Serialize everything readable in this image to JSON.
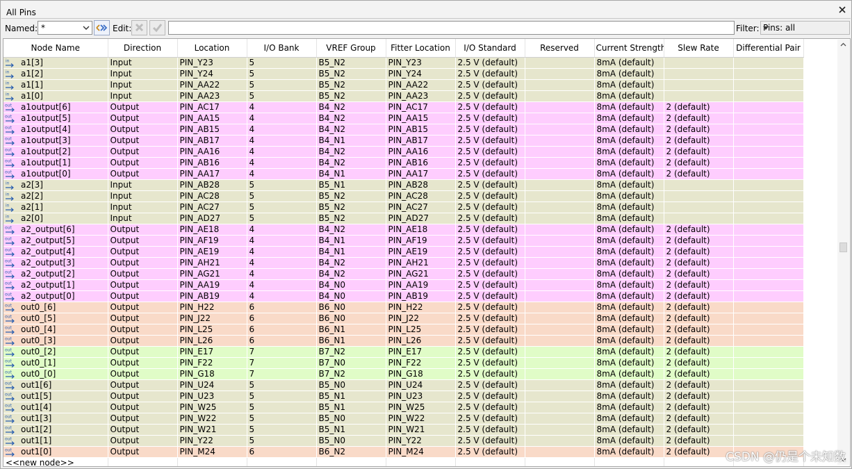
{
  "window": {
    "title": "All Pins"
  },
  "toolbar": {
    "named_label": "Named:",
    "named_value": "*",
    "edit_label": "Edit:",
    "edit_value": "",
    "filter_label": "Filter:",
    "filter_value": "Pins: all"
  },
  "columns": [
    "Node Name",
    "Direction",
    "Location",
    "I/O Bank",
    "VREF Group",
    "Fitter Location",
    "I/O Standard",
    "Reserved",
    "Current Strength",
    "Slew Rate",
    "Differential Pair"
  ],
  "colors": {
    "input_row": "#e6e6cd",
    "output_bank4": "#fecdfe",
    "output_bank6": "#f9dac8",
    "output_bank7": "#e0fcc7",
    "output_bank5": "#e6e6cd",
    "input_icon": "#3c7fc7",
    "output_icon": "#3c7fc7"
  },
  "rows": [
    {
      "icon": "input-pin-icon",
      "name": "a1[3]",
      "direction": "Input",
      "location": "PIN_Y23",
      "bank": "5",
      "vref": "B5_N2",
      "fitter": "PIN_Y23",
      "standard": "2.5 V (default)",
      "reserved": "",
      "strength": "8mA (default)",
      "slew": "",
      "diff": "",
      "color": "#e6e6cd"
    },
    {
      "icon": "input-pin-icon",
      "name": "a1[2]",
      "direction": "Input",
      "location": "PIN_Y24",
      "bank": "5",
      "vref": "B5_N2",
      "fitter": "PIN_Y24",
      "standard": "2.5 V (default)",
      "reserved": "",
      "strength": "8mA (default)",
      "slew": "",
      "diff": "",
      "color": "#e6e6cd"
    },
    {
      "icon": "input-pin-icon",
      "name": "a1[1]",
      "direction": "Input",
      "location": "PIN_AA22",
      "bank": "5",
      "vref": "B5_N2",
      "fitter": "PIN_AA22",
      "standard": "2.5 V (default)",
      "reserved": "",
      "strength": "8mA (default)",
      "slew": "",
      "diff": "",
      "color": "#e6e6cd"
    },
    {
      "icon": "input-pin-icon",
      "name": "a1[0]",
      "direction": "Input",
      "location": "PIN_AA23",
      "bank": "5",
      "vref": "B5_N2",
      "fitter": "PIN_AA23",
      "standard": "2.5 V (default)",
      "reserved": "",
      "strength": "8mA (default)",
      "slew": "",
      "diff": "",
      "color": "#e6e6cd"
    },
    {
      "icon": "output-pin-icon",
      "name": "a1output[6]",
      "direction": "Output",
      "location": "PIN_AC17",
      "bank": "4",
      "vref": "B4_N2",
      "fitter": "PIN_AC17",
      "standard": "2.5 V (default)",
      "reserved": "",
      "strength": "8mA (default)",
      "slew": "2 (default)",
      "diff": "",
      "color": "#fecdfe"
    },
    {
      "icon": "output-pin-icon",
      "name": "a1output[5]",
      "direction": "Output",
      "location": "PIN_AA15",
      "bank": "4",
      "vref": "B4_N2",
      "fitter": "PIN_AA15",
      "standard": "2.5 V (default)",
      "reserved": "",
      "strength": "8mA (default)",
      "slew": "2 (default)",
      "diff": "",
      "color": "#fecdfe"
    },
    {
      "icon": "output-pin-icon",
      "name": "a1output[4]",
      "direction": "Output",
      "location": "PIN_AB15",
      "bank": "4",
      "vref": "B4_N2",
      "fitter": "PIN_AB15",
      "standard": "2.5 V (default)",
      "reserved": "",
      "strength": "8mA (default)",
      "slew": "2 (default)",
      "diff": "",
      "color": "#fecdfe"
    },
    {
      "icon": "output-pin-icon",
      "name": "a1output[3]",
      "direction": "Output",
      "location": "PIN_AB17",
      "bank": "4",
      "vref": "B4_N1",
      "fitter": "PIN_AB17",
      "standard": "2.5 V (default)",
      "reserved": "",
      "strength": "8mA (default)",
      "slew": "2 (default)",
      "diff": "",
      "color": "#fecdfe"
    },
    {
      "icon": "output-pin-icon",
      "name": "a1output[2]",
      "direction": "Output",
      "location": "PIN_AA16",
      "bank": "4",
      "vref": "B4_N2",
      "fitter": "PIN_AA16",
      "standard": "2.5 V (default)",
      "reserved": "",
      "strength": "8mA (default)",
      "slew": "2 (default)",
      "diff": "",
      "color": "#fecdfe"
    },
    {
      "icon": "output-pin-icon",
      "name": "a1output[1]",
      "direction": "Output",
      "location": "PIN_AB16",
      "bank": "4",
      "vref": "B4_N2",
      "fitter": "PIN_AB16",
      "standard": "2.5 V (default)",
      "reserved": "",
      "strength": "8mA (default)",
      "slew": "2 (default)",
      "diff": "",
      "color": "#fecdfe"
    },
    {
      "icon": "output-pin-icon",
      "name": "a1output[0]",
      "direction": "Output",
      "location": "PIN_AA17",
      "bank": "4",
      "vref": "B4_N1",
      "fitter": "PIN_AA17",
      "standard": "2.5 V (default)",
      "reserved": "",
      "strength": "8mA (default)",
      "slew": "2 (default)",
      "diff": "",
      "color": "#fecdfe"
    },
    {
      "icon": "input-pin-icon",
      "name": "a2[3]",
      "direction": "Input",
      "location": "PIN_AB28",
      "bank": "5",
      "vref": "B5_N1",
      "fitter": "PIN_AB28",
      "standard": "2.5 V (default)",
      "reserved": "",
      "strength": "8mA (default)",
      "slew": "",
      "diff": "",
      "color": "#e6e6cd"
    },
    {
      "icon": "input-pin-icon",
      "name": "a2[2]",
      "direction": "Input",
      "location": "PIN_AC28",
      "bank": "5",
      "vref": "B5_N2",
      "fitter": "PIN_AC28",
      "standard": "2.5 V (default)",
      "reserved": "",
      "strength": "8mA (default)",
      "slew": "",
      "diff": "",
      "color": "#e6e6cd"
    },
    {
      "icon": "input-pin-icon",
      "name": "a2[1]",
      "direction": "Input",
      "location": "PIN_AC27",
      "bank": "5",
      "vref": "B5_N2",
      "fitter": "PIN_AC27",
      "standard": "2.5 V (default)",
      "reserved": "",
      "strength": "8mA (default)",
      "slew": "",
      "diff": "",
      "color": "#e6e6cd"
    },
    {
      "icon": "input-pin-icon",
      "name": "a2[0]",
      "direction": "Input",
      "location": "PIN_AD27",
      "bank": "5",
      "vref": "B5_N2",
      "fitter": "PIN_AD27",
      "standard": "2.5 V (default)",
      "reserved": "",
      "strength": "8mA (default)",
      "slew": "",
      "diff": "",
      "color": "#e6e6cd"
    },
    {
      "icon": "output-pin-icon",
      "name": "a2_output[6]",
      "direction": "Output",
      "location": "PIN_AE18",
      "bank": "4",
      "vref": "B4_N2",
      "fitter": "PIN_AE18",
      "standard": "2.5 V (default)",
      "reserved": "",
      "strength": "8mA (default)",
      "slew": "2 (default)",
      "diff": "",
      "color": "#fecdfe"
    },
    {
      "icon": "output-pin-icon",
      "name": "a2_output[5]",
      "direction": "Output",
      "location": "PIN_AF19",
      "bank": "4",
      "vref": "B4_N1",
      "fitter": "PIN_AF19",
      "standard": "2.5 V (default)",
      "reserved": "",
      "strength": "8mA (default)",
      "slew": "2 (default)",
      "diff": "",
      "color": "#fecdfe"
    },
    {
      "icon": "output-pin-icon",
      "name": "a2_output[4]",
      "direction": "Output",
      "location": "PIN_AE19",
      "bank": "4",
      "vref": "B4_N1",
      "fitter": "PIN_AE19",
      "standard": "2.5 V (default)",
      "reserved": "",
      "strength": "8mA (default)",
      "slew": "2 (default)",
      "diff": "",
      "color": "#fecdfe"
    },
    {
      "icon": "output-pin-icon",
      "name": "a2_output[3]",
      "direction": "Output",
      "location": "PIN_AH21",
      "bank": "4",
      "vref": "B4_N2",
      "fitter": "PIN_AH21",
      "standard": "2.5 V (default)",
      "reserved": "",
      "strength": "8mA (default)",
      "slew": "2 (default)",
      "diff": "",
      "color": "#fecdfe"
    },
    {
      "icon": "output-pin-icon",
      "name": "a2_output[2]",
      "direction": "Output",
      "location": "PIN_AG21",
      "bank": "4",
      "vref": "B4_N2",
      "fitter": "PIN_AG21",
      "standard": "2.5 V (default)",
      "reserved": "",
      "strength": "8mA (default)",
      "slew": "2 (default)",
      "diff": "",
      "color": "#fecdfe"
    },
    {
      "icon": "output-pin-icon",
      "name": "a2_output[1]",
      "direction": "Output",
      "location": "PIN_AA19",
      "bank": "4",
      "vref": "B4_N0",
      "fitter": "PIN_AA19",
      "standard": "2.5 V (default)",
      "reserved": "",
      "strength": "8mA (default)",
      "slew": "2 (default)",
      "diff": "",
      "color": "#fecdfe"
    },
    {
      "icon": "output-pin-icon",
      "name": "a2_output[0]",
      "direction": "Output",
      "location": "PIN_AB19",
      "bank": "4",
      "vref": "B4_N0",
      "fitter": "PIN_AB19",
      "standard": "2.5 V (default)",
      "reserved": "",
      "strength": "8mA (default)",
      "slew": "2 (default)",
      "diff": "",
      "color": "#fecdfe"
    },
    {
      "icon": "output-pin-icon",
      "name": "out0_[6]",
      "direction": "Output",
      "location": "PIN_H22",
      "bank": "6",
      "vref": "B6_N0",
      "fitter": "PIN_H22",
      "standard": "2.5 V (default)",
      "reserved": "",
      "strength": "8mA (default)",
      "slew": "2 (default)",
      "diff": "",
      "color": "#f9dac8"
    },
    {
      "icon": "output-pin-icon",
      "name": "out0_[5]",
      "direction": "Output",
      "location": "PIN_J22",
      "bank": "6",
      "vref": "B6_N0",
      "fitter": "PIN_J22",
      "standard": "2.5 V (default)",
      "reserved": "",
      "strength": "8mA (default)",
      "slew": "2 (default)",
      "diff": "",
      "color": "#f9dac8"
    },
    {
      "icon": "output-pin-icon",
      "name": "out0_[4]",
      "direction": "Output",
      "location": "PIN_L25",
      "bank": "6",
      "vref": "B6_N1",
      "fitter": "PIN_L25",
      "standard": "2.5 V (default)",
      "reserved": "",
      "strength": "8mA (default)",
      "slew": "2 (default)",
      "diff": "",
      "color": "#f9dac8"
    },
    {
      "icon": "output-pin-icon",
      "name": "out0_[3]",
      "direction": "Output",
      "location": "PIN_L26",
      "bank": "6",
      "vref": "B6_N1",
      "fitter": "PIN_L26",
      "standard": "2.5 V (default)",
      "reserved": "",
      "strength": "8mA (default)",
      "slew": "2 (default)",
      "diff": "",
      "color": "#f9dac8"
    },
    {
      "icon": "output-pin-icon",
      "name": "out0_[2]",
      "direction": "Output",
      "location": "PIN_E17",
      "bank": "7",
      "vref": "B7_N2",
      "fitter": "PIN_E17",
      "standard": "2.5 V (default)",
      "reserved": "",
      "strength": "8mA (default)",
      "slew": "2 (default)",
      "diff": "",
      "color": "#e0fcc7"
    },
    {
      "icon": "output-pin-icon",
      "name": "out0_[1]",
      "direction": "Output",
      "location": "PIN_F22",
      "bank": "7",
      "vref": "B7_N0",
      "fitter": "PIN_F22",
      "standard": "2.5 V (default)",
      "reserved": "",
      "strength": "8mA (default)",
      "slew": "2 (default)",
      "diff": "",
      "color": "#e0fcc7"
    },
    {
      "icon": "output-pin-icon",
      "name": "out0_[0]",
      "direction": "Output",
      "location": "PIN_G18",
      "bank": "7",
      "vref": "B7_N2",
      "fitter": "PIN_G18",
      "standard": "2.5 V (default)",
      "reserved": "",
      "strength": "8mA (default)",
      "slew": "2 (default)",
      "diff": "",
      "color": "#e0fcc7"
    },
    {
      "icon": "output-pin-icon",
      "name": "out1[6]",
      "direction": "Output",
      "location": "PIN_U24",
      "bank": "5",
      "vref": "B5_N0",
      "fitter": "PIN_U24",
      "standard": "2.5 V (default)",
      "reserved": "",
      "strength": "8mA (default)",
      "slew": "2 (default)",
      "diff": "",
      "color": "#e6e6cd"
    },
    {
      "icon": "output-pin-icon",
      "name": "out1[5]",
      "direction": "Output",
      "location": "PIN_U23",
      "bank": "5",
      "vref": "B5_N1",
      "fitter": "PIN_U23",
      "standard": "2.5 V (default)",
      "reserved": "",
      "strength": "8mA (default)",
      "slew": "2 (default)",
      "diff": "",
      "color": "#e6e6cd"
    },
    {
      "icon": "output-pin-icon",
      "name": "out1[4]",
      "direction": "Output",
      "location": "PIN_W25",
      "bank": "5",
      "vref": "B5_N1",
      "fitter": "PIN_W25",
      "standard": "2.5 V (default)",
      "reserved": "",
      "strength": "8mA (default)",
      "slew": "2 (default)",
      "diff": "",
      "color": "#e6e6cd"
    },
    {
      "icon": "output-pin-icon",
      "name": "out1[3]",
      "direction": "Output",
      "location": "PIN_W22",
      "bank": "5",
      "vref": "B5_N0",
      "fitter": "PIN_W22",
      "standard": "2.5 V (default)",
      "reserved": "",
      "strength": "8mA (default)",
      "slew": "2 (default)",
      "diff": "",
      "color": "#e6e6cd"
    },
    {
      "icon": "output-pin-icon",
      "name": "out1[2]",
      "direction": "Output",
      "location": "PIN_W21",
      "bank": "5",
      "vref": "B5_N1",
      "fitter": "PIN_W21",
      "standard": "2.5 V (default)",
      "reserved": "",
      "strength": "8mA (default)",
      "slew": "2 (default)",
      "diff": "",
      "color": "#e6e6cd"
    },
    {
      "icon": "output-pin-icon",
      "name": "out1[1]",
      "direction": "Output",
      "location": "PIN_Y22",
      "bank": "5",
      "vref": "B5_N0",
      "fitter": "PIN_Y22",
      "standard": "2.5 V (default)",
      "reserved": "",
      "strength": "8mA (default)",
      "slew": "2 (default)",
      "diff": "",
      "color": "#e6e6cd"
    },
    {
      "icon": "output-pin-icon",
      "name": "out1[0]",
      "direction": "Output",
      "location": "PIN_M24",
      "bank": "6",
      "vref": "B6_N2",
      "fitter": "PIN_M24",
      "standard": "2.5 V (default)",
      "reserved": "",
      "strength": "8mA (default)",
      "slew": "2 (default)",
      "diff": "",
      "color": "#f9dac8"
    }
  ],
  "new_node_label": "<<new node>>",
  "watermark": "CSDN @仍是个未知数"
}
